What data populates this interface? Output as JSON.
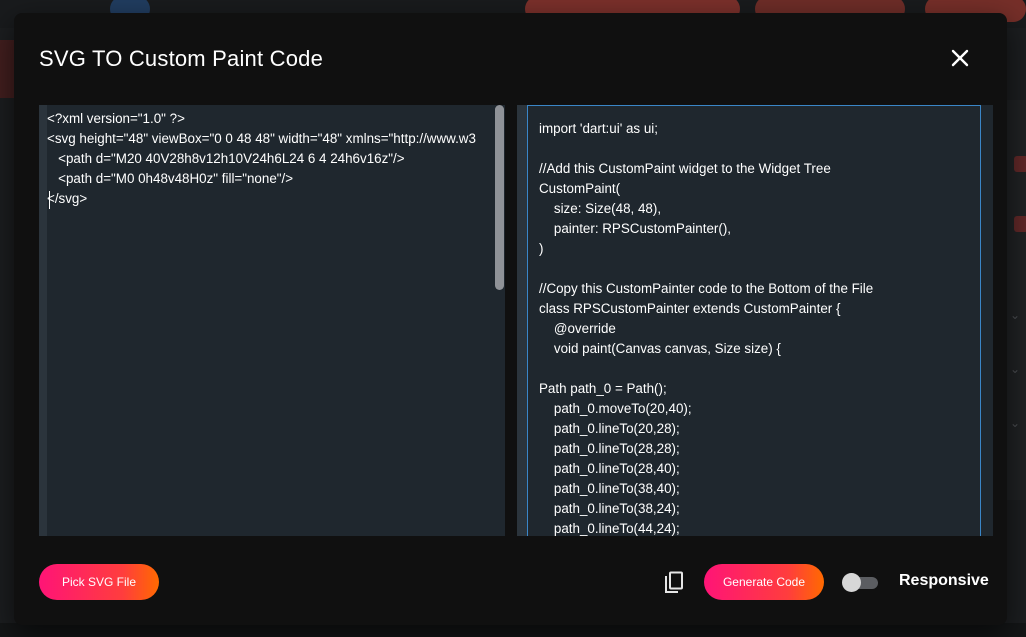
{
  "dialog": {
    "title": "SVG TO Custom Paint Code",
    "close_icon": "close-icon"
  },
  "input_editor": {
    "lines": [
      "<?xml version=\"1.0\" ?>",
      "<svg height=\"48\" viewBox=\"0 0 48 48\" width=\"48\" xmlns=\"http://www.w3",
      "   <path d=\"M20 40V28h8v12h10V24h6L24 6 4 24h6v16z\"/>",
      "   <path d=\"M0 0h48v48H0z\" fill=\"none\"/>",
      "</svg>"
    ]
  },
  "output_editor": {
    "lines": [
      "import 'dart:ui' as ui;",
      "",
      "//Add this CustomPaint widget to the Widget Tree",
      "CustomPaint(",
      "    size: Size(48, 48),",
      "    painter: RPSCustomPainter(),",
      ")",
      "",
      "//Copy this CustomPainter code to the Bottom of the File",
      "class RPSCustomPainter extends CustomPainter {",
      "    @override",
      "    void paint(Canvas canvas, Size size) {",
      "",
      "Path path_0 = Path();",
      "    path_0.moveTo(20,40);",
      "    path_0.lineTo(20,28);",
      "    path_0.lineTo(28,28);",
      "    path_0.lineTo(28,40);",
      "    path_0.lineTo(38,40);",
      "    path_0.lineTo(38,24);",
      "    path_0.lineTo(44,24);"
    ]
  },
  "footer": {
    "pick_label": "Pick SVG File",
    "copy_icon": "copy-icon",
    "generate_label": "Generate Code",
    "responsive_label": "Responsive",
    "responsive_on": false
  },
  "colors": {
    "dialog_bg": "#101010",
    "editor_bg": "#1f272e",
    "accent_gradient_start": "#ff1477",
    "accent_gradient_end": "#ff6a00",
    "focus_border": "#3a86c8"
  }
}
